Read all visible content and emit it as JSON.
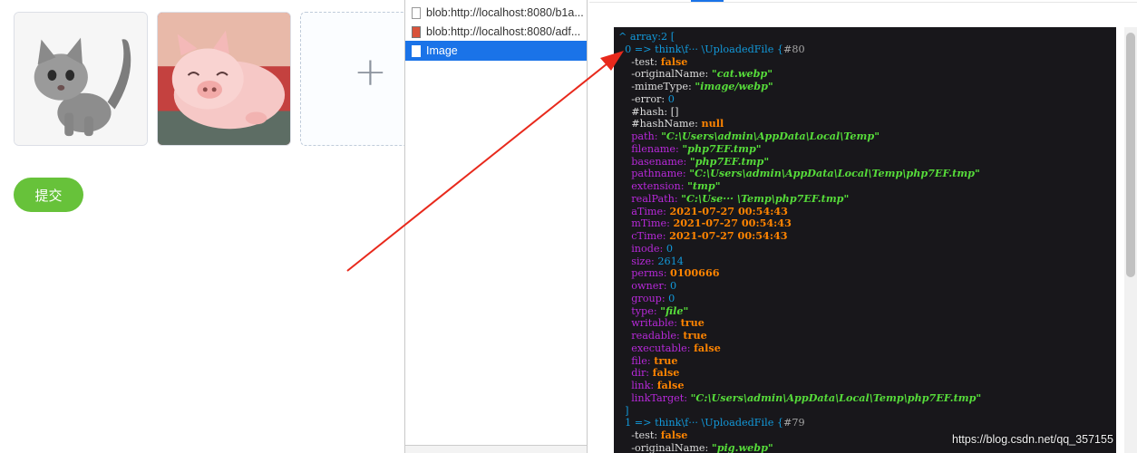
{
  "uploader": {
    "thumbnails": [
      {
        "name": "cat-thumbnail",
        "icon": "kitten-image"
      },
      {
        "name": "pig-thumbnail",
        "icon": "pig-plush-image"
      }
    ],
    "add_symbol": "+",
    "submit_label": "提交"
  },
  "list": {
    "items": [
      {
        "label": "blob:http://localhost:8080/b1a...",
        "icon": "document-icon"
      },
      {
        "label": "blob:http://localhost:8080/adf...",
        "icon": "image-file-icon"
      },
      {
        "label": "Image",
        "icon": "document-icon",
        "selected": true
      }
    ]
  },
  "dump": {
    "header": "^ array:2 [",
    "entries": [
      {
        "prefix": "  0 => think\\f··· \\UploadedFile {",
        "ref": "#80"
      },
      {
        "key": "    -test: ",
        "val": "false",
        "type": "b"
      },
      {
        "key": "    -originalName: ",
        "val": "\"cat.webp\"",
        "type": "k"
      },
      {
        "key": "    -mimeType: ",
        "val": "\"image/webp\"",
        "type": "k"
      },
      {
        "key": "    -error: ",
        "val": "0",
        "type": "n"
      },
      {
        "key": "    #hash: ",
        "val": "[]",
        "type": "w"
      },
      {
        "key": "    #hashName: ",
        "val": "null",
        "type": "b"
      },
      {
        "key": "    path: ",
        "val": "\"C:\\Users\\admin\\AppData\\Local\\Temp\"",
        "type": "k"
      },
      {
        "key": "    filename: ",
        "val": "\"php7EF.tmp\"",
        "type": "k"
      },
      {
        "key": "    basename: ",
        "val": "\"php7EF.tmp\"",
        "type": "k"
      },
      {
        "key": "    pathname: ",
        "val": "\"C:\\Users\\admin\\AppData\\Local\\Temp\\php7EF.tmp\"",
        "type": "k"
      },
      {
        "key": "    extension: ",
        "val": "\"tmp\"",
        "type": "k"
      },
      {
        "key": "    realPath: ",
        "val": "\"C:\\Use··· \\Temp\\php7EF.tmp\"",
        "type": "k"
      },
      {
        "key": "    aTime: ",
        "val": "2021-07-27 00:54:43",
        "type": "b"
      },
      {
        "key": "    mTime: ",
        "val": "2021-07-27 00:54:43",
        "type": "b"
      },
      {
        "key": "    cTime: ",
        "val": "2021-07-27 00:54:43",
        "type": "b"
      },
      {
        "key": "    inode: ",
        "val": "0",
        "type": "n"
      },
      {
        "key": "    size: ",
        "val": "2614",
        "type": "n"
      },
      {
        "key": "    perms: ",
        "val": "0100666",
        "type": "b"
      },
      {
        "key": "    owner: ",
        "val": "0",
        "type": "n"
      },
      {
        "key": "    group: ",
        "val": "0",
        "type": "n"
      },
      {
        "key": "    type: ",
        "val": "\"file\"",
        "type": "k"
      },
      {
        "key": "    writable: ",
        "val": "true",
        "type": "b"
      },
      {
        "key": "    readable: ",
        "val": "true",
        "type": "b"
      },
      {
        "key": "    executable: ",
        "val": "false",
        "type": "b"
      },
      {
        "key": "    file: ",
        "val": "true",
        "type": "b"
      },
      {
        "key": "    dir: ",
        "val": "false",
        "type": "b"
      },
      {
        "key": "    link: ",
        "val": "false",
        "type": "b"
      },
      {
        "key": "    linkTarget: ",
        "val": "\"C:\\Users\\admin\\AppData\\Local\\Temp\\php7EF.tmp\"",
        "type": "k"
      },
      {
        "prefix": "  ]"
      },
      {
        "prefix": "  1 => think\\f··· \\UploadedFile {",
        "ref": "#79"
      },
      {
        "key": "    -test: ",
        "val": "false",
        "type": "b"
      },
      {
        "key": "    -originalName: ",
        "val": "\"pig.webp\"",
        "type": "k"
      }
    ]
  },
  "watermark": "https://blog.csdn.net/qq_357155",
  "colors": {
    "submit_green": "#67c23a",
    "selection_blue": "#1a73e8",
    "dump_bg": "#18171b",
    "arrow_red": "#e8291c"
  }
}
